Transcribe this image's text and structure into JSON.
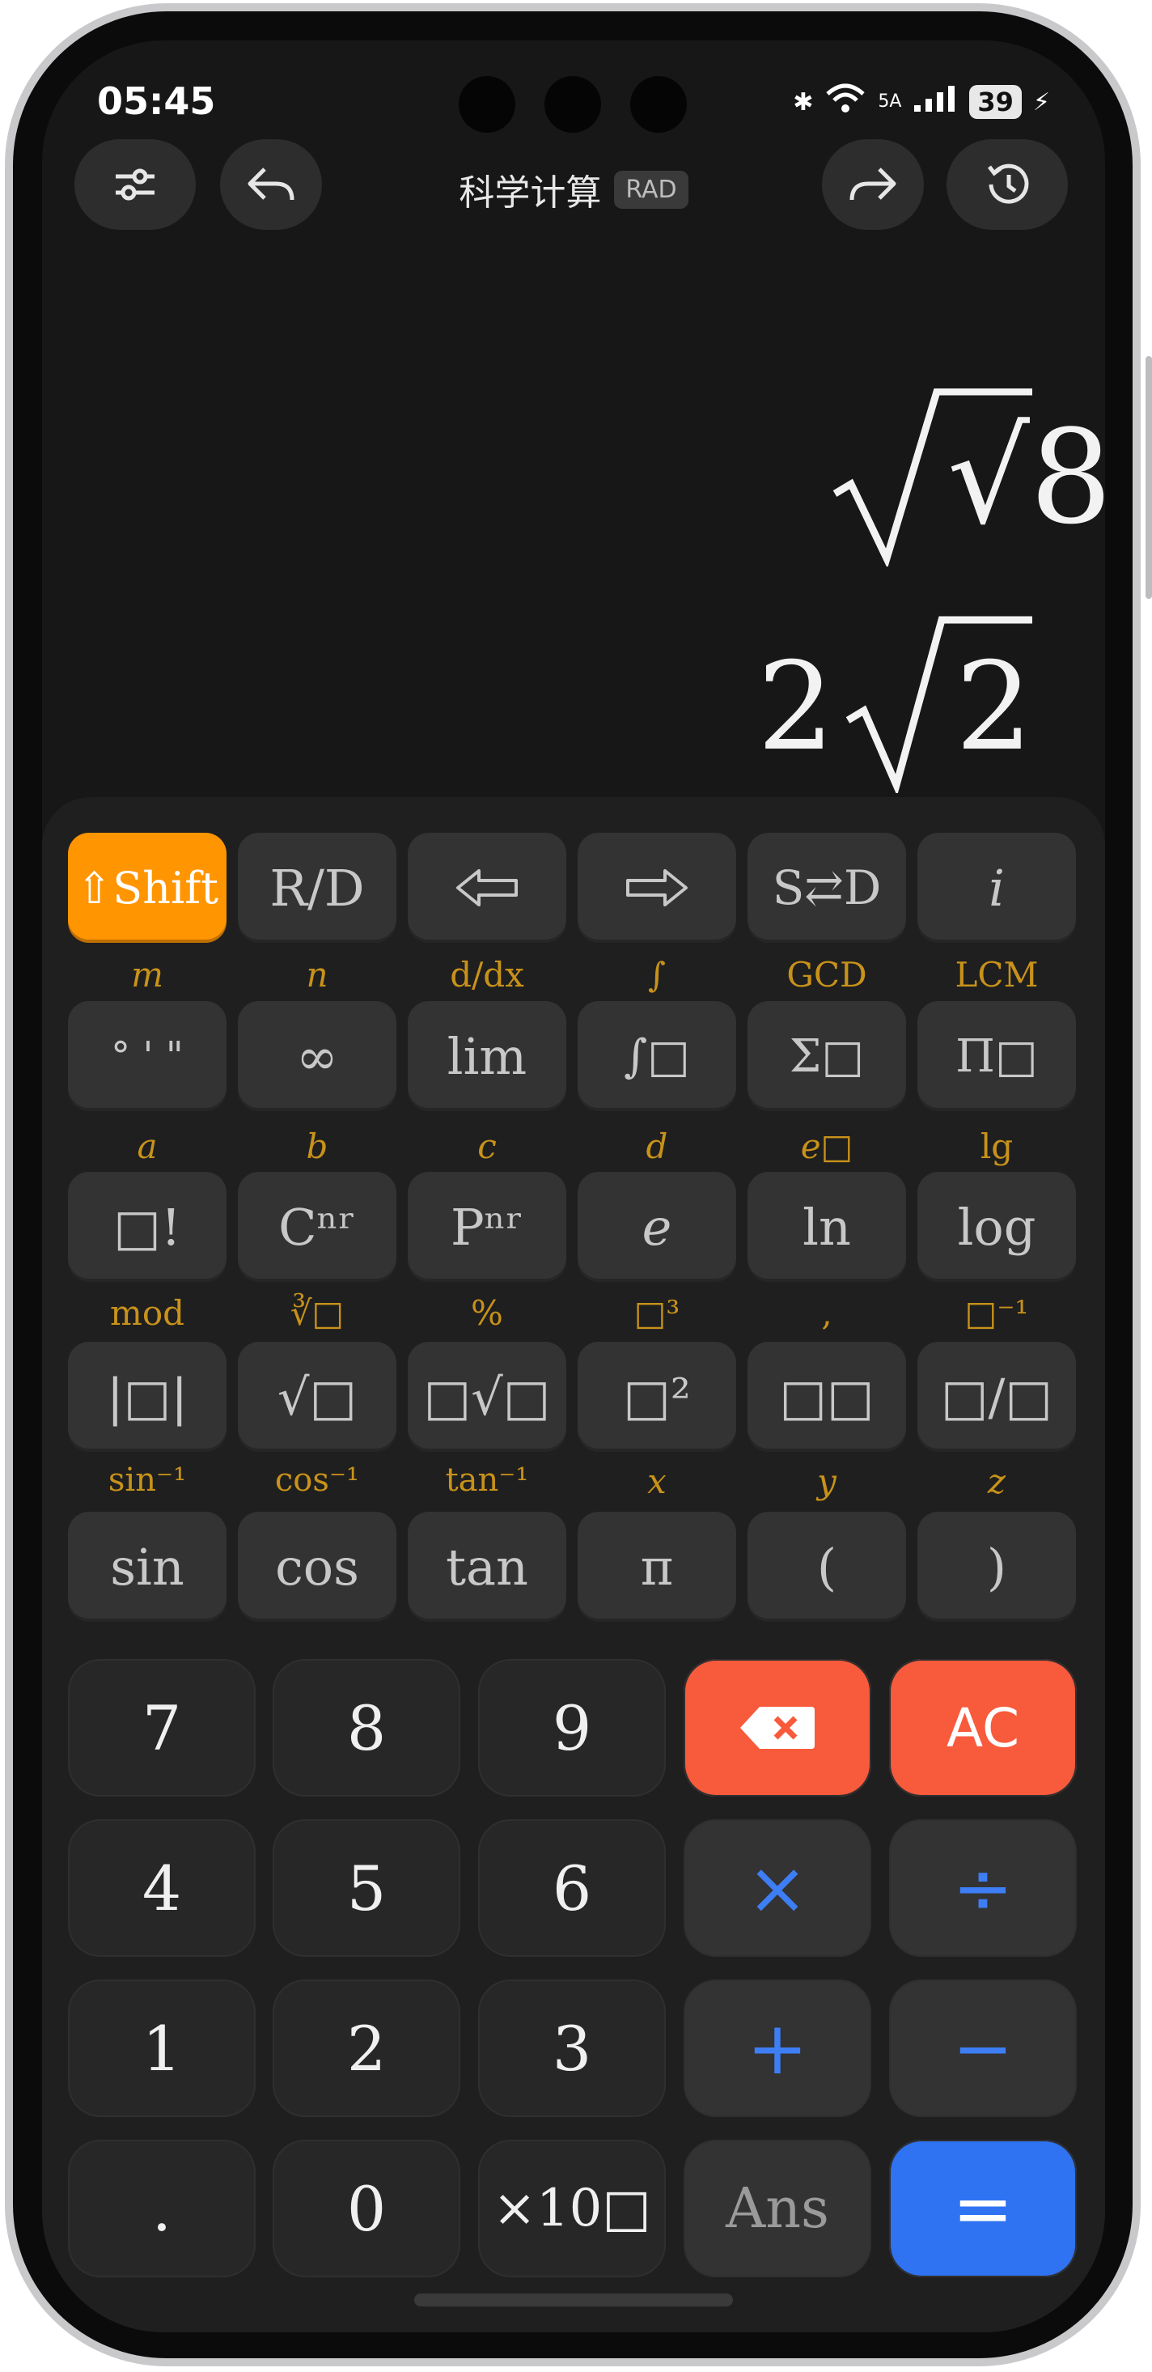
{
  "status": {
    "time": "05:45",
    "network": "5A",
    "battery": "39"
  },
  "header": {
    "title": "科学计算",
    "mode": "RAD"
  },
  "display": {
    "expression": "√8",
    "result_coeff": "2",
    "result_radicand": "2"
  },
  "keys": {
    "row1": [
      "⇧Shift",
      "R/D",
      "⇦",
      "⇨",
      "S⇄D",
      "i"
    ],
    "labels2": [
      "m",
      "n",
      "d/dx",
      "∫",
      "GCD",
      "LCM"
    ],
    "row2": [
      "° ' \"",
      "∞",
      "lim",
      "∫□",
      "Σ□",
      "Π□"
    ],
    "labels3": [
      "a",
      "b",
      "c",
      "d",
      "e□",
      "lg"
    ],
    "row3": [
      "□!",
      "Cⁿʳ",
      "Pⁿʳ",
      "e",
      "ln",
      "log"
    ],
    "labels4": [
      "mod",
      "∛□",
      "%",
      "□³",
      ",",
      "□⁻¹"
    ],
    "row4": [
      "|□|",
      "√□",
      "□√□",
      "□²",
      "□□",
      "□/□"
    ],
    "labels5": [
      "sin⁻¹",
      "cos⁻¹",
      "tan⁻¹",
      "x",
      "y",
      "z"
    ],
    "row5": [
      "sin",
      "cos",
      "tan",
      "π",
      "(",
      ")"
    ],
    "pad": [
      [
        "7",
        "8",
        "9",
        "⌫",
        "AC"
      ],
      [
        "4",
        "5",
        "6",
        "×",
        "÷"
      ],
      [
        "1",
        "2",
        "3",
        "+",
        "−"
      ],
      [
        ".",
        "0",
        "×10□",
        "Ans",
        "="
      ]
    ]
  }
}
